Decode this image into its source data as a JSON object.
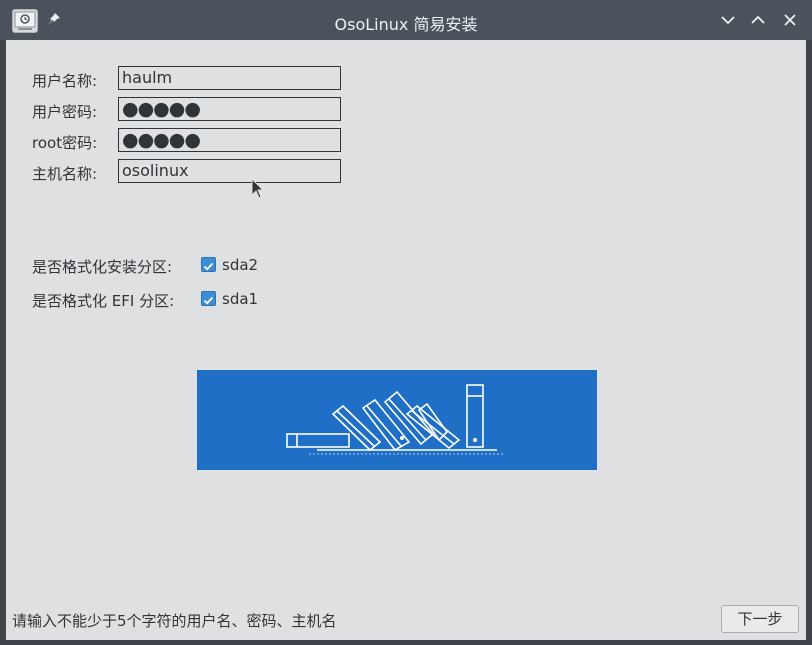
{
  "window": {
    "title": "OsoLinux 简易安装",
    "icons": {
      "app": "installer-app-icon",
      "pin": "pin-icon",
      "minimize": "chevron-down-icon",
      "maximize": "chevron-up-icon",
      "close": "close-icon"
    }
  },
  "form": {
    "username_label": "用户名称:",
    "username_value": "haulm",
    "user_password_label": "用户密码:",
    "user_password_mask": "●●●●●",
    "root_password_label": "root密码:",
    "root_password_mask": "●●●●●",
    "hostname_label": "主机名称:",
    "hostname_value": "osolinux"
  },
  "format_options": {
    "install_partition_label": "是否格式化安装分区:",
    "install_partition_checkbox": "sda2",
    "install_partition_checked": true,
    "efi_partition_label": "是否格式化 EFI 分区:",
    "efi_partition_checkbox": "sda1",
    "efi_partition_checked": true
  },
  "banner": {
    "icon": "books-illustration-icon",
    "background": "#1f6fc7"
  },
  "footer": {
    "status_text": "请输入不能少于5个字符的用户名、密码、主机名",
    "next_button": "下一步"
  }
}
